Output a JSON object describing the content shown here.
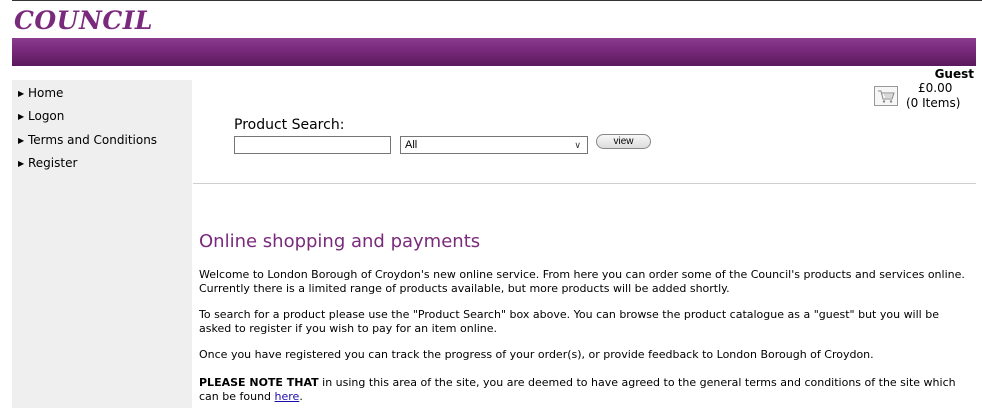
{
  "header": {
    "logo_text": "COUNCIL",
    "brand_color": "#7a2a7c"
  },
  "sidebar": {
    "items": [
      {
        "label": "Home",
        "icon": "triangle-right-icon"
      },
      {
        "label": "Logon",
        "icon": "triangle-right-icon"
      },
      {
        "label": "Terms and Conditions",
        "icon": "triangle-right-icon"
      },
      {
        "label": "Register",
        "icon": "triangle-right-icon"
      }
    ]
  },
  "user_box": {
    "user": "Guest",
    "cart_total": "£0.00",
    "cart_items": "(0 Items)",
    "cart_icon": "shopping-cart-icon"
  },
  "search": {
    "label": "Product Search:",
    "input_value": "",
    "category_selected": "All",
    "button_label": "view"
  },
  "content": {
    "title": "Online shopping and payments",
    "para1": "Welcome to London Borough of Croydon's new online service. From here you can order some of the Council's products and services online. Currently there is a limited range of products available, but more products will be added shortly.",
    "para2": "To search for a product please use the \"Product Search\" box above. You can browse the product catalogue as a \"guest\" but you will be asked to register if you wish to pay for an item online.",
    "para3": "Once you have registered you can track the progress of your order(s), or provide feedback to London Borough of Croydon.",
    "para4_bold": "PLEASE NOTE THAT",
    "para4_text": " in using this area of the site, you are deemed to have agreed to the general terms and conditions of the site which can be found ",
    "para4_link": "here",
    "para4_end": "."
  }
}
